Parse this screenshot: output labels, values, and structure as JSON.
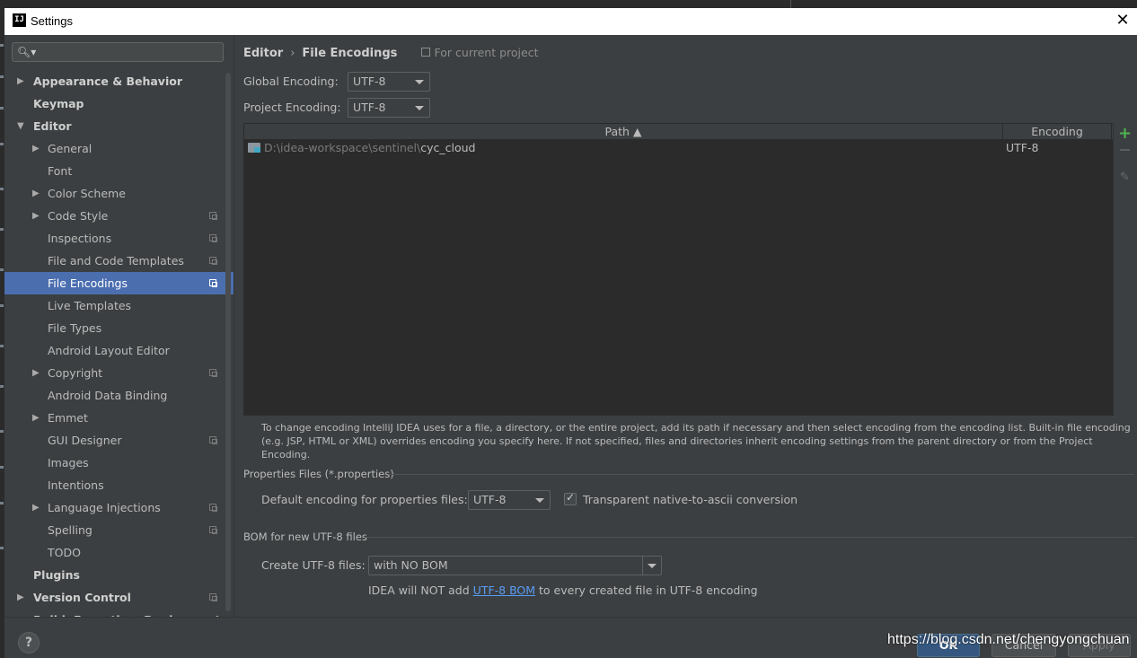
{
  "window": {
    "title": "Settings",
    "app_icon": "IJ"
  },
  "search": {
    "placeholder": ""
  },
  "sidebar": {
    "items": [
      {
        "label": "Appearance & Behavior",
        "level": 0,
        "arrow": "right",
        "project": false
      },
      {
        "label": "Keymap",
        "level": 0,
        "arrow": "",
        "project": false
      },
      {
        "label": "Editor",
        "level": 0,
        "arrow": "down",
        "project": false
      },
      {
        "label": "General",
        "level": 1,
        "arrow": "right",
        "project": false
      },
      {
        "label": "Font",
        "level": 1,
        "arrow": "",
        "project": false
      },
      {
        "label": "Color Scheme",
        "level": 1,
        "arrow": "right",
        "project": false
      },
      {
        "label": "Code Style",
        "level": 1,
        "arrow": "right",
        "project": true
      },
      {
        "label": "Inspections",
        "level": 1,
        "arrow": "",
        "project": true
      },
      {
        "label": "File and Code Templates",
        "level": 1,
        "arrow": "",
        "project": true
      },
      {
        "label": "File Encodings",
        "level": 1,
        "arrow": "",
        "project": true,
        "selected": true
      },
      {
        "label": "Live Templates",
        "level": 1,
        "arrow": "",
        "project": false
      },
      {
        "label": "File Types",
        "level": 1,
        "arrow": "",
        "project": false
      },
      {
        "label": "Android Layout Editor",
        "level": 1,
        "arrow": "",
        "project": false
      },
      {
        "label": "Copyright",
        "level": 1,
        "arrow": "right",
        "project": true
      },
      {
        "label": "Android Data Binding",
        "level": 1,
        "arrow": "",
        "project": false
      },
      {
        "label": "Emmet",
        "level": 1,
        "arrow": "right",
        "project": false
      },
      {
        "label": "GUI Designer",
        "level": 1,
        "arrow": "",
        "project": true
      },
      {
        "label": "Images",
        "level": 1,
        "arrow": "",
        "project": false
      },
      {
        "label": "Intentions",
        "level": 1,
        "arrow": "",
        "project": false
      },
      {
        "label": "Language Injections",
        "level": 1,
        "arrow": "right",
        "project": true
      },
      {
        "label": "Spelling",
        "level": 1,
        "arrow": "",
        "project": true
      },
      {
        "label": "TODO",
        "level": 1,
        "arrow": "",
        "project": false
      },
      {
        "label": "Plugins",
        "level": 0,
        "arrow": "",
        "project": false
      },
      {
        "label": "Version Control",
        "level": 0,
        "arrow": "right",
        "project": true
      },
      {
        "label": "Build, Execution, Deployment",
        "level": 0,
        "arrow": "right",
        "project": false
      }
    ]
  },
  "breadcrumb": {
    "parent": "Editor",
    "current": "File Encodings",
    "note": "For current project"
  },
  "global_encoding": {
    "label": "Global Encoding:",
    "value": "UTF-8"
  },
  "project_encoding": {
    "label": "Project Encoding:",
    "value": "UTF-8"
  },
  "table": {
    "columns": {
      "path": "Path ▲",
      "encoding": "Encoding"
    },
    "rows": [
      {
        "path_prefix": "D:\\idea-workspace\\sentinel\\",
        "path_name": "cyc_cloud",
        "encoding": "UTF-8"
      }
    ]
  },
  "tools": {
    "add": "+",
    "edit": "✎"
  },
  "hint": "To change encoding IntelliJ IDEA uses for a file, a directory, or the entire project, add its path if necessary and then select encoding from the encoding list. Built-in file encoding (e.g. JSP, HTML or XML) overrides encoding you specify here. If not specified, files and directories inherit encoding settings from the parent directory or from the Project Encoding.",
  "properties_section": {
    "title": "Properties Files (*.properties)",
    "default_label": "Default encoding for properties files:",
    "default_value": "UTF-8",
    "transparent_label": "Transparent native-to-ascii conversion",
    "transparent_checked": true
  },
  "bom_section": {
    "title": "BOM for new UTF-8 files",
    "create_label": "Create UTF-8 files:",
    "create_value": "with NO BOM",
    "note_before": "IDEA will NOT add ",
    "note_link": "UTF-8 BOM",
    "note_after": " to every created file in UTF-8 encoding"
  },
  "buttons": {
    "help": "?",
    "ok": "OK",
    "cancel": "Cancel",
    "apply": "Apply"
  },
  "watermark": "https://blog.csdn.net/chengyongchuan",
  "colors": {
    "accent": "#4b6eaf",
    "link": "#589df6",
    "add": "#4fb34f"
  }
}
